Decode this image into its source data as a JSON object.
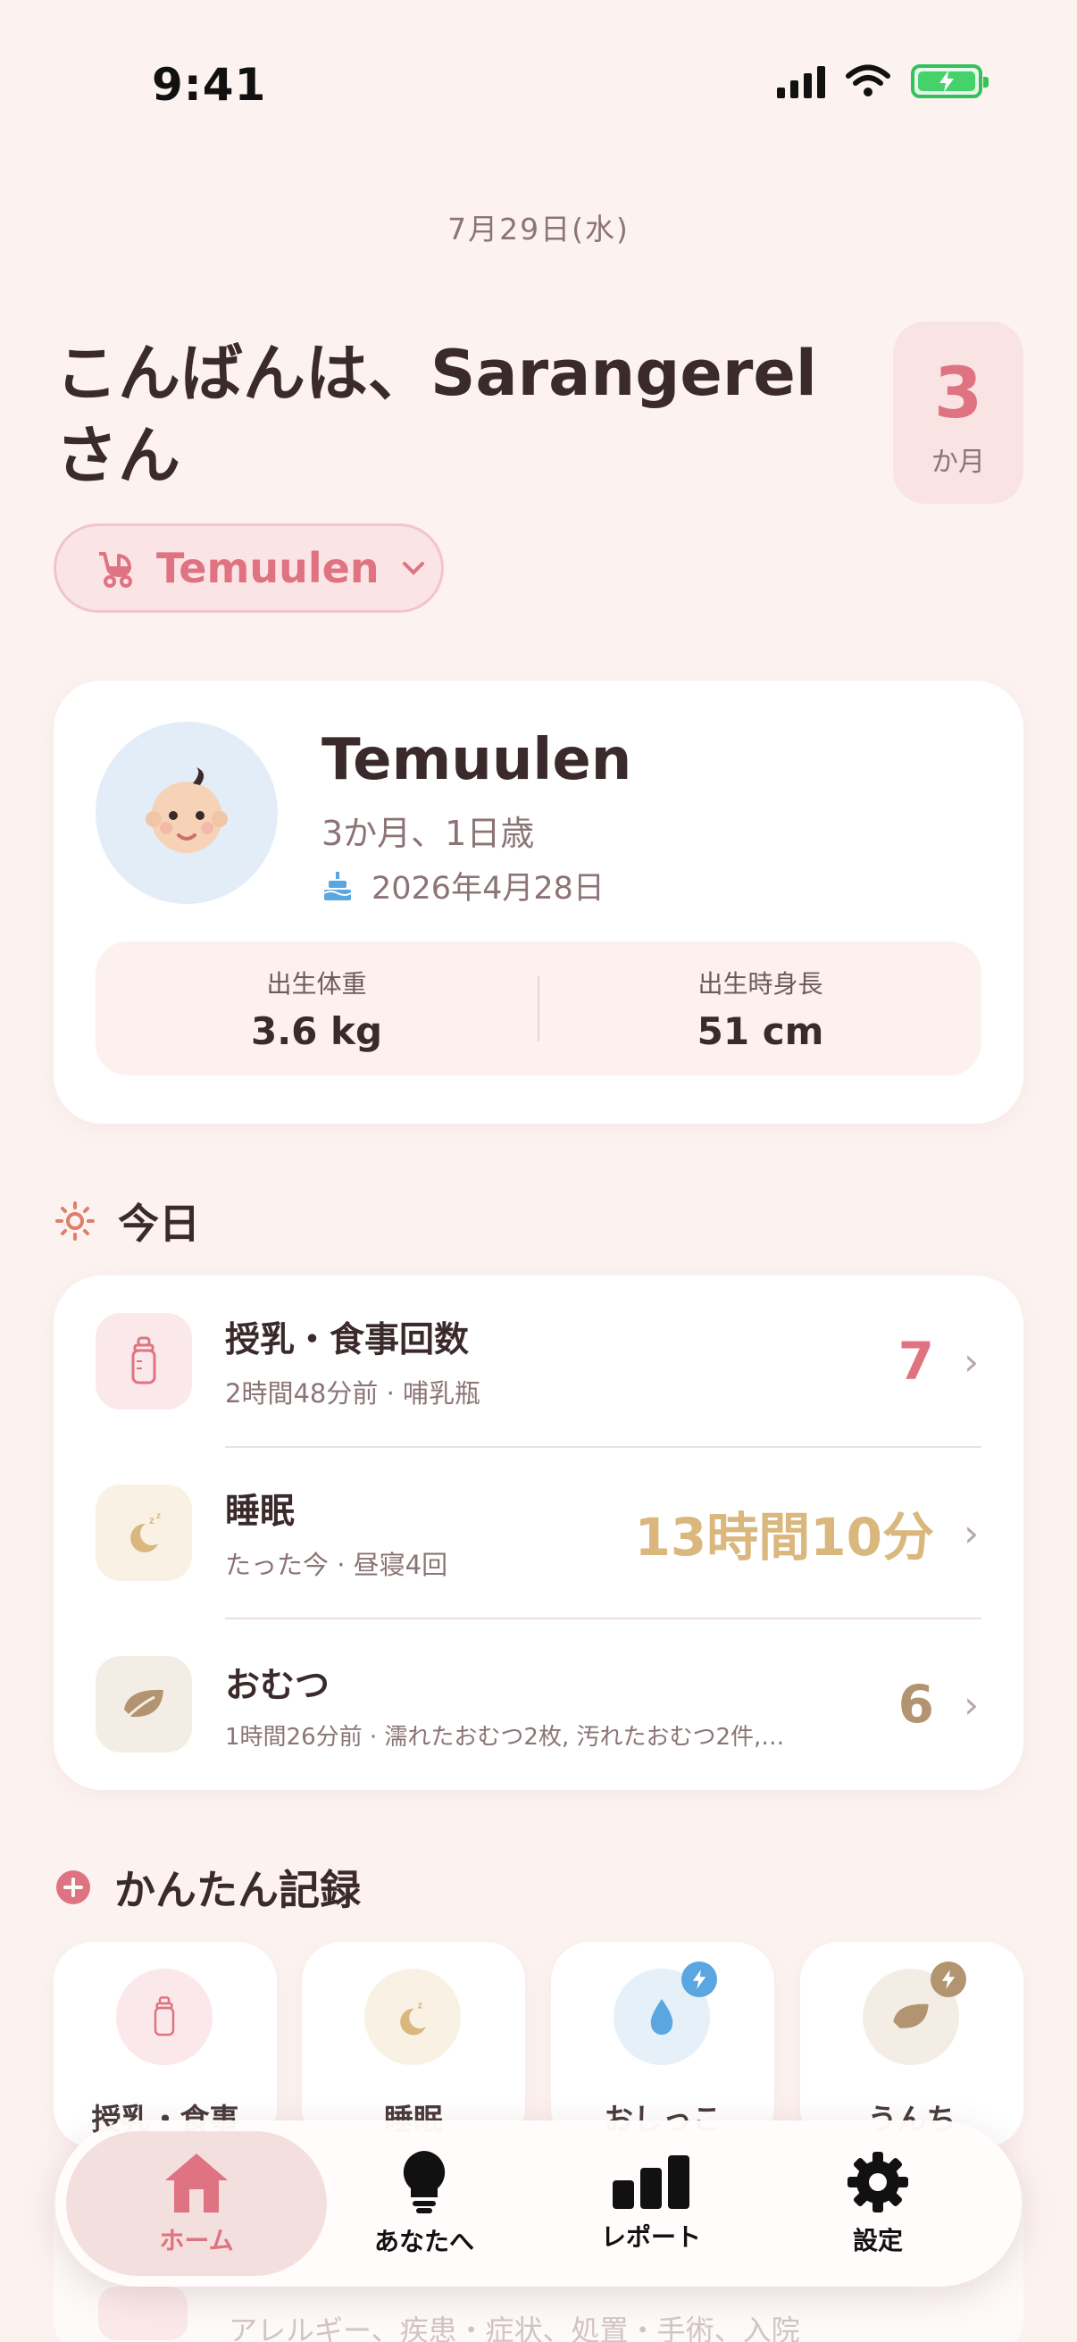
{
  "status_bar": {
    "time": "9:41"
  },
  "header": {
    "date": "7月29日(水)",
    "greeting": "こんばんは、Sarangerel さん",
    "age_value": "3",
    "age_unit": "か月"
  },
  "baby_selector": {
    "name": "Temuulen"
  },
  "profile": {
    "name": "Temuulen",
    "age_text": "3か月、1日歳",
    "birthday": "2026年4月28日",
    "stats": [
      {
        "label": "出生体重",
        "value": "3.6 kg"
      },
      {
        "label": "出生時身長",
        "value": "51 cm"
      }
    ]
  },
  "today": {
    "title": "今日",
    "rows": [
      {
        "title": "授乳・食事回数",
        "sub": "2時間48分前 · 哺乳瓶",
        "value": "7",
        "icon": "bottle-icon",
        "color": "#df7381"
      },
      {
        "title": "睡眠",
        "sub": "たった今 · 昼寝4回",
        "value": "13時間10分",
        "icon": "moon-icon",
        "color": "#d9b77d"
      },
      {
        "title": "おむつ",
        "sub": "1時間26分前 · 濡れたおむつ2枚, 汚れたおむつ2件,…",
        "value": "6",
        "icon": "leaf-icon",
        "color": "#b39470"
      }
    ]
  },
  "quick_log": {
    "title": "かんたん記録",
    "items": [
      {
        "label": "授乳・食事",
        "icon": "bottle-icon"
      },
      {
        "label": "睡眠",
        "icon": "moon-icon"
      },
      {
        "label": "おしっこ",
        "icon": "drop-icon"
      },
      {
        "label": "うんち",
        "icon": "leaf-icon"
      }
    ]
  },
  "hidden_row": {
    "sub": "アレルギー、疾患・症状、処置・手術、入院"
  },
  "tabbar": {
    "tabs": [
      {
        "label": "ホーム",
        "icon": "home-icon"
      },
      {
        "label": "あなたへ",
        "icon": "lightbulb-icon"
      },
      {
        "label": "レポート",
        "icon": "bar-chart-icon"
      },
      {
        "label": "設定",
        "icon": "gear-icon"
      }
    ]
  },
  "colors": {
    "accent": "#df7381",
    "background": "#fcf3f1",
    "sleep": "#d9b77d",
    "diaper": "#b39470",
    "pee": "#5aa6e0"
  }
}
